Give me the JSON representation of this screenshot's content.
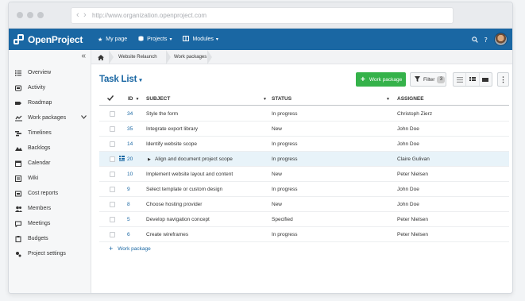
{
  "browser": {
    "url": "http://www.organization.openproject.com",
    "back_glyph": "‹",
    "forward_glyph": "›"
  },
  "app": {
    "name": "OpenProject"
  },
  "topnav": {
    "my_page": "My page",
    "projects": "Projects",
    "modules": "Modules"
  },
  "sidebar": {
    "collapse_glyph": "«",
    "items": [
      {
        "label": "Overview",
        "icon": "list-icon"
      },
      {
        "label": "Activity",
        "icon": "activity-icon"
      },
      {
        "label": "Roadmap",
        "icon": "roadmap-icon"
      },
      {
        "label": "Work packages",
        "icon": "work-packages-icon"
      },
      {
        "label": "Timelines",
        "icon": "timelines-icon"
      },
      {
        "label": "Backlogs",
        "icon": "backlogs-icon"
      },
      {
        "label": "Calendar",
        "icon": "calendar-icon"
      },
      {
        "label": "Wiki",
        "icon": "wiki-icon"
      },
      {
        "label": "Cost reports",
        "icon": "cost-reports-icon"
      },
      {
        "label": "Members",
        "icon": "members-icon"
      },
      {
        "label": "Meetings",
        "icon": "meetings-icon"
      },
      {
        "label": "Budgets",
        "icon": "budgets-icon"
      },
      {
        "label": "Project settings",
        "icon": "settings-icon"
      }
    ]
  },
  "breadcrumb": {
    "project": "Website Relaunch",
    "page": "Work packages"
  },
  "toolbar": {
    "title": "Task List",
    "work_package_button": "Work package",
    "filter_label": "Filter",
    "filter_count": "3",
    "more_glyph": "⋮"
  },
  "table": {
    "columns": {
      "id": "ID",
      "subject": "SUBJECT",
      "status": "STATUS",
      "assignee": "ASSIGNEE"
    },
    "rows": [
      {
        "id": "34",
        "subject": "Style the form",
        "status": "In progress",
        "assignee": "Christoph Zierz"
      },
      {
        "id": "35",
        "subject": "Integrate export library",
        "status": "New",
        "assignee": "John Doe"
      },
      {
        "id": "14",
        "subject": "Identify website scope",
        "status": "In progress",
        "assignee": "John Doe"
      },
      {
        "id": "20",
        "subject": "Align and document project scope",
        "status": "In progress",
        "assignee": "Claire Gulivan"
      },
      {
        "id": "10",
        "subject": "Implement website layout and content",
        "status": "New",
        "assignee": "Peter Nielsen"
      },
      {
        "id": "9",
        "subject": "Select template or custom design",
        "status": "In progress",
        "assignee": "John Doe"
      },
      {
        "id": "8",
        "subject": "Choose hosting provider",
        "status": "New",
        "assignee": "John Doe"
      },
      {
        "id": "5",
        "subject": "Develop navigation concept",
        "status": "Specified",
        "assignee": "Peter Nielsen"
      },
      {
        "id": "6",
        "subject": "Create wireframes",
        "status": "In progress",
        "assignee": "Peter Nielsen"
      }
    ],
    "add_label": "Work package"
  },
  "colors": {
    "brand": "#1a67a3",
    "accent_green": "#35b24a",
    "highlight_row": "#e8f3f9"
  }
}
